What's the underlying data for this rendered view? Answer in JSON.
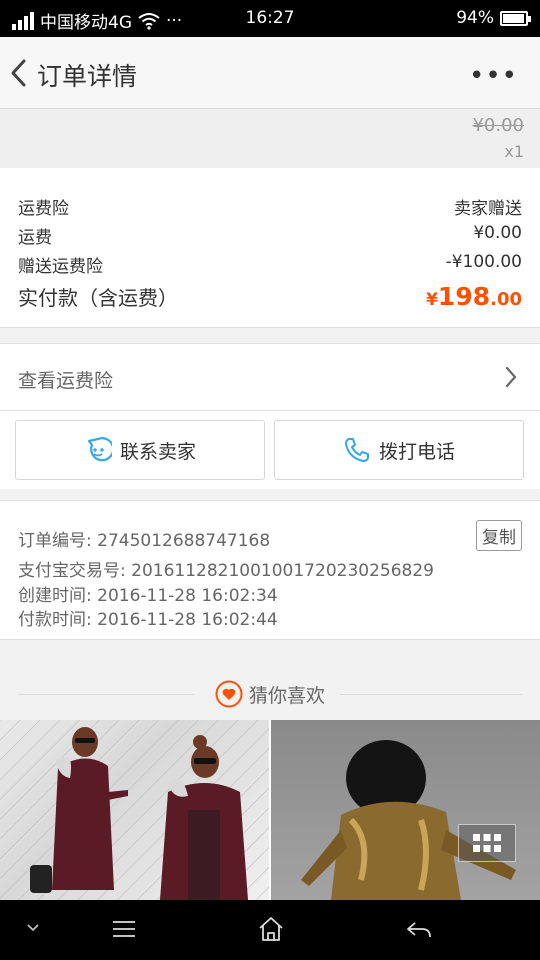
{
  "status_bar": {
    "carrier": "中国移动4G",
    "dots": "···",
    "time": "16:27",
    "battery": "94%",
    "battery_level": 0.94
  },
  "navbar": {
    "title": "订单详情",
    "more": "•••"
  },
  "product": {
    "original_price": "¥0.00",
    "quantity": "x1"
  },
  "fees": {
    "insurance_label": "运费险",
    "insurance_value": "卖家赠送",
    "shipping_label": "运费",
    "shipping_value": "¥0.00",
    "gift_label": "赠送运费险",
    "gift_value": "-¥100.00",
    "total_label": "实付款（含运费）",
    "total_currency": "¥",
    "total_int": "198",
    "total_dec": ".00"
  },
  "insurance_link": {
    "label": "查看运费险"
  },
  "contact": {
    "seller_label": "联系卖家",
    "call_label": "拨打电话"
  },
  "order_info": {
    "order_no": "订单编号: 2745012688747168",
    "alipay_no": "支付宝交易号: 2016112821001001720230256829",
    "created": "创建时间: 2016-11-28 16:02:34",
    "paid": "付款时间: 2016-11-28 16:02:44",
    "copy_label": "复制"
  },
  "recommend": {
    "title": "猜你喜欢"
  },
  "colors": {
    "accent": "#ff5000",
    "icon_blue": "#33a9e8"
  }
}
